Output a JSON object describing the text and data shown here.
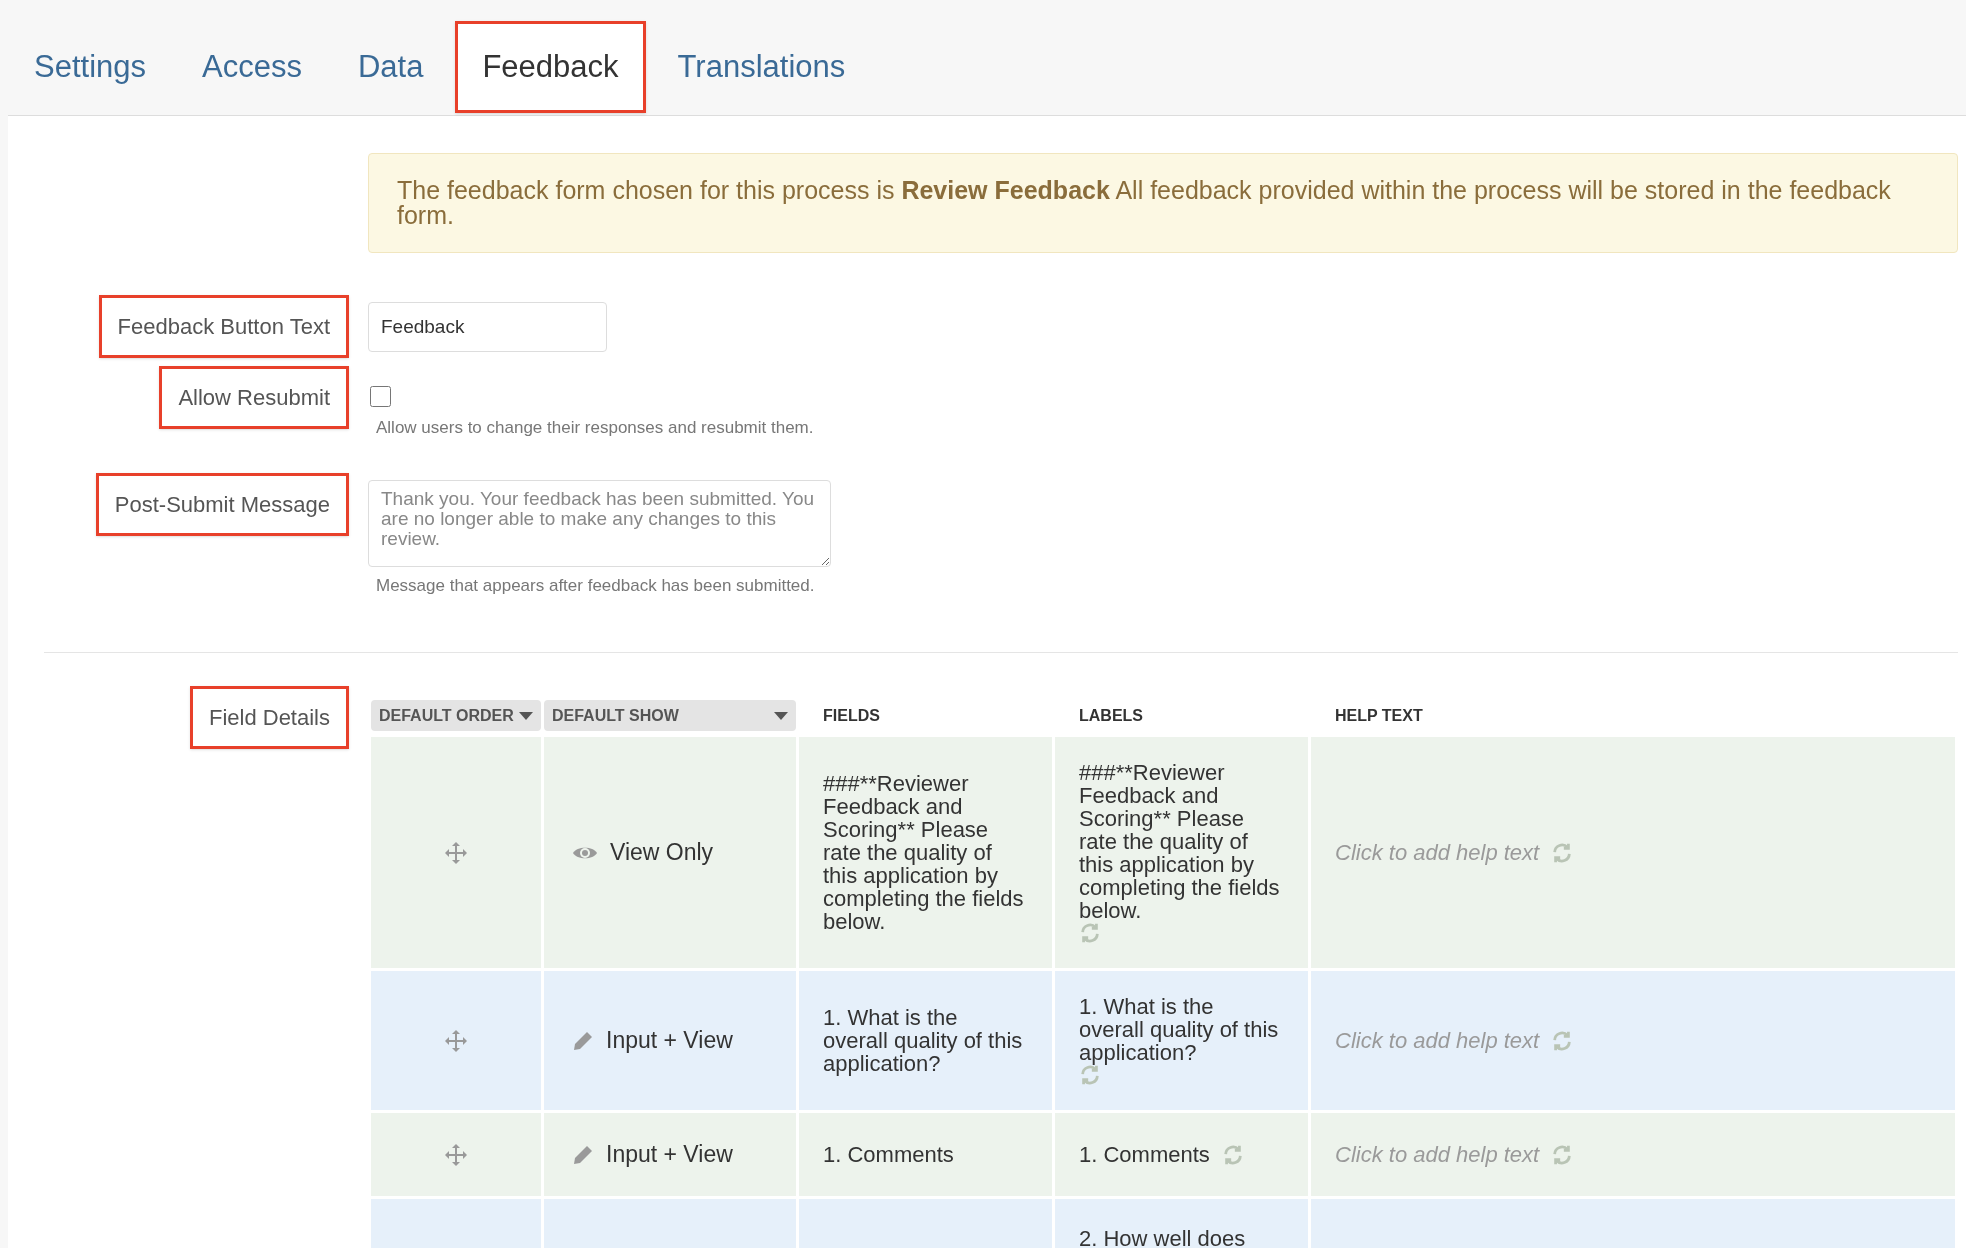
{
  "tabs": [
    {
      "label": "Settings",
      "selected": false
    },
    {
      "label": "Access",
      "selected": false
    },
    {
      "label": "Data",
      "selected": false
    },
    {
      "label": "Feedback",
      "selected": true
    },
    {
      "label": "Translations",
      "selected": false
    }
  ],
  "alert": "The feedback form chosen for this process is **Review Feedback** All feedback provided within the process will be stored in the feedback form.",
  "form": {
    "button_text": {
      "label": "Feedback Button Text",
      "annotated": true,
      "value": "Feedback"
    },
    "allow_resubmit": {
      "label": "Allow Resubmit",
      "annotated": true,
      "checked": false,
      "help": "Allow users to change their responses and resubmit them."
    },
    "post_submit": {
      "label": "Post-Submit Message",
      "annotated": true,
      "placeholder": "Thank you. Your feedback has been submitted. You are no longer able to make any changes to this review.",
      "help": "Message that appears after feedback has been submitted."
    }
  },
  "field_details": {
    "label": "Field Details",
    "annotated": true,
    "columns": [
      {
        "label": "DEFAULT ORDER",
        "kind": "dropdown"
      },
      {
        "label": "DEFAULT SHOW",
        "kind": "dropdown"
      },
      {
        "label": "FIELDS",
        "kind": "plain"
      },
      {
        "label": "LABELS",
        "kind": "plain"
      },
      {
        "label": "HELP TEXT",
        "kind": "plain"
      }
    ],
    "rows": [
      {
        "show": "View Only",
        "kind": "view",
        "field": "###**Reviewer Feedback and Scoring** Please rate the quality of this application by completing the fields below.",
        "label": "###**Reviewer Feedback and Scoring** Please rate the quality of this application by completing the fields below.",
        "help": "Click to add help text"
      },
      {
        "show": "Input + View",
        "kind": "input",
        "field": "1. What is the overall quality of this application?",
        "label": "1. What is the overall quality of this application?",
        "help": "Click to add help text"
      },
      {
        "show": "Input + View",
        "kind": "input",
        "field": "1. Comments",
        "label": "1. Comments",
        "help": "Click to add help text"
      },
      {
        "kind": "partial",
        "label": "2. How well does"
      }
    ]
  }
}
